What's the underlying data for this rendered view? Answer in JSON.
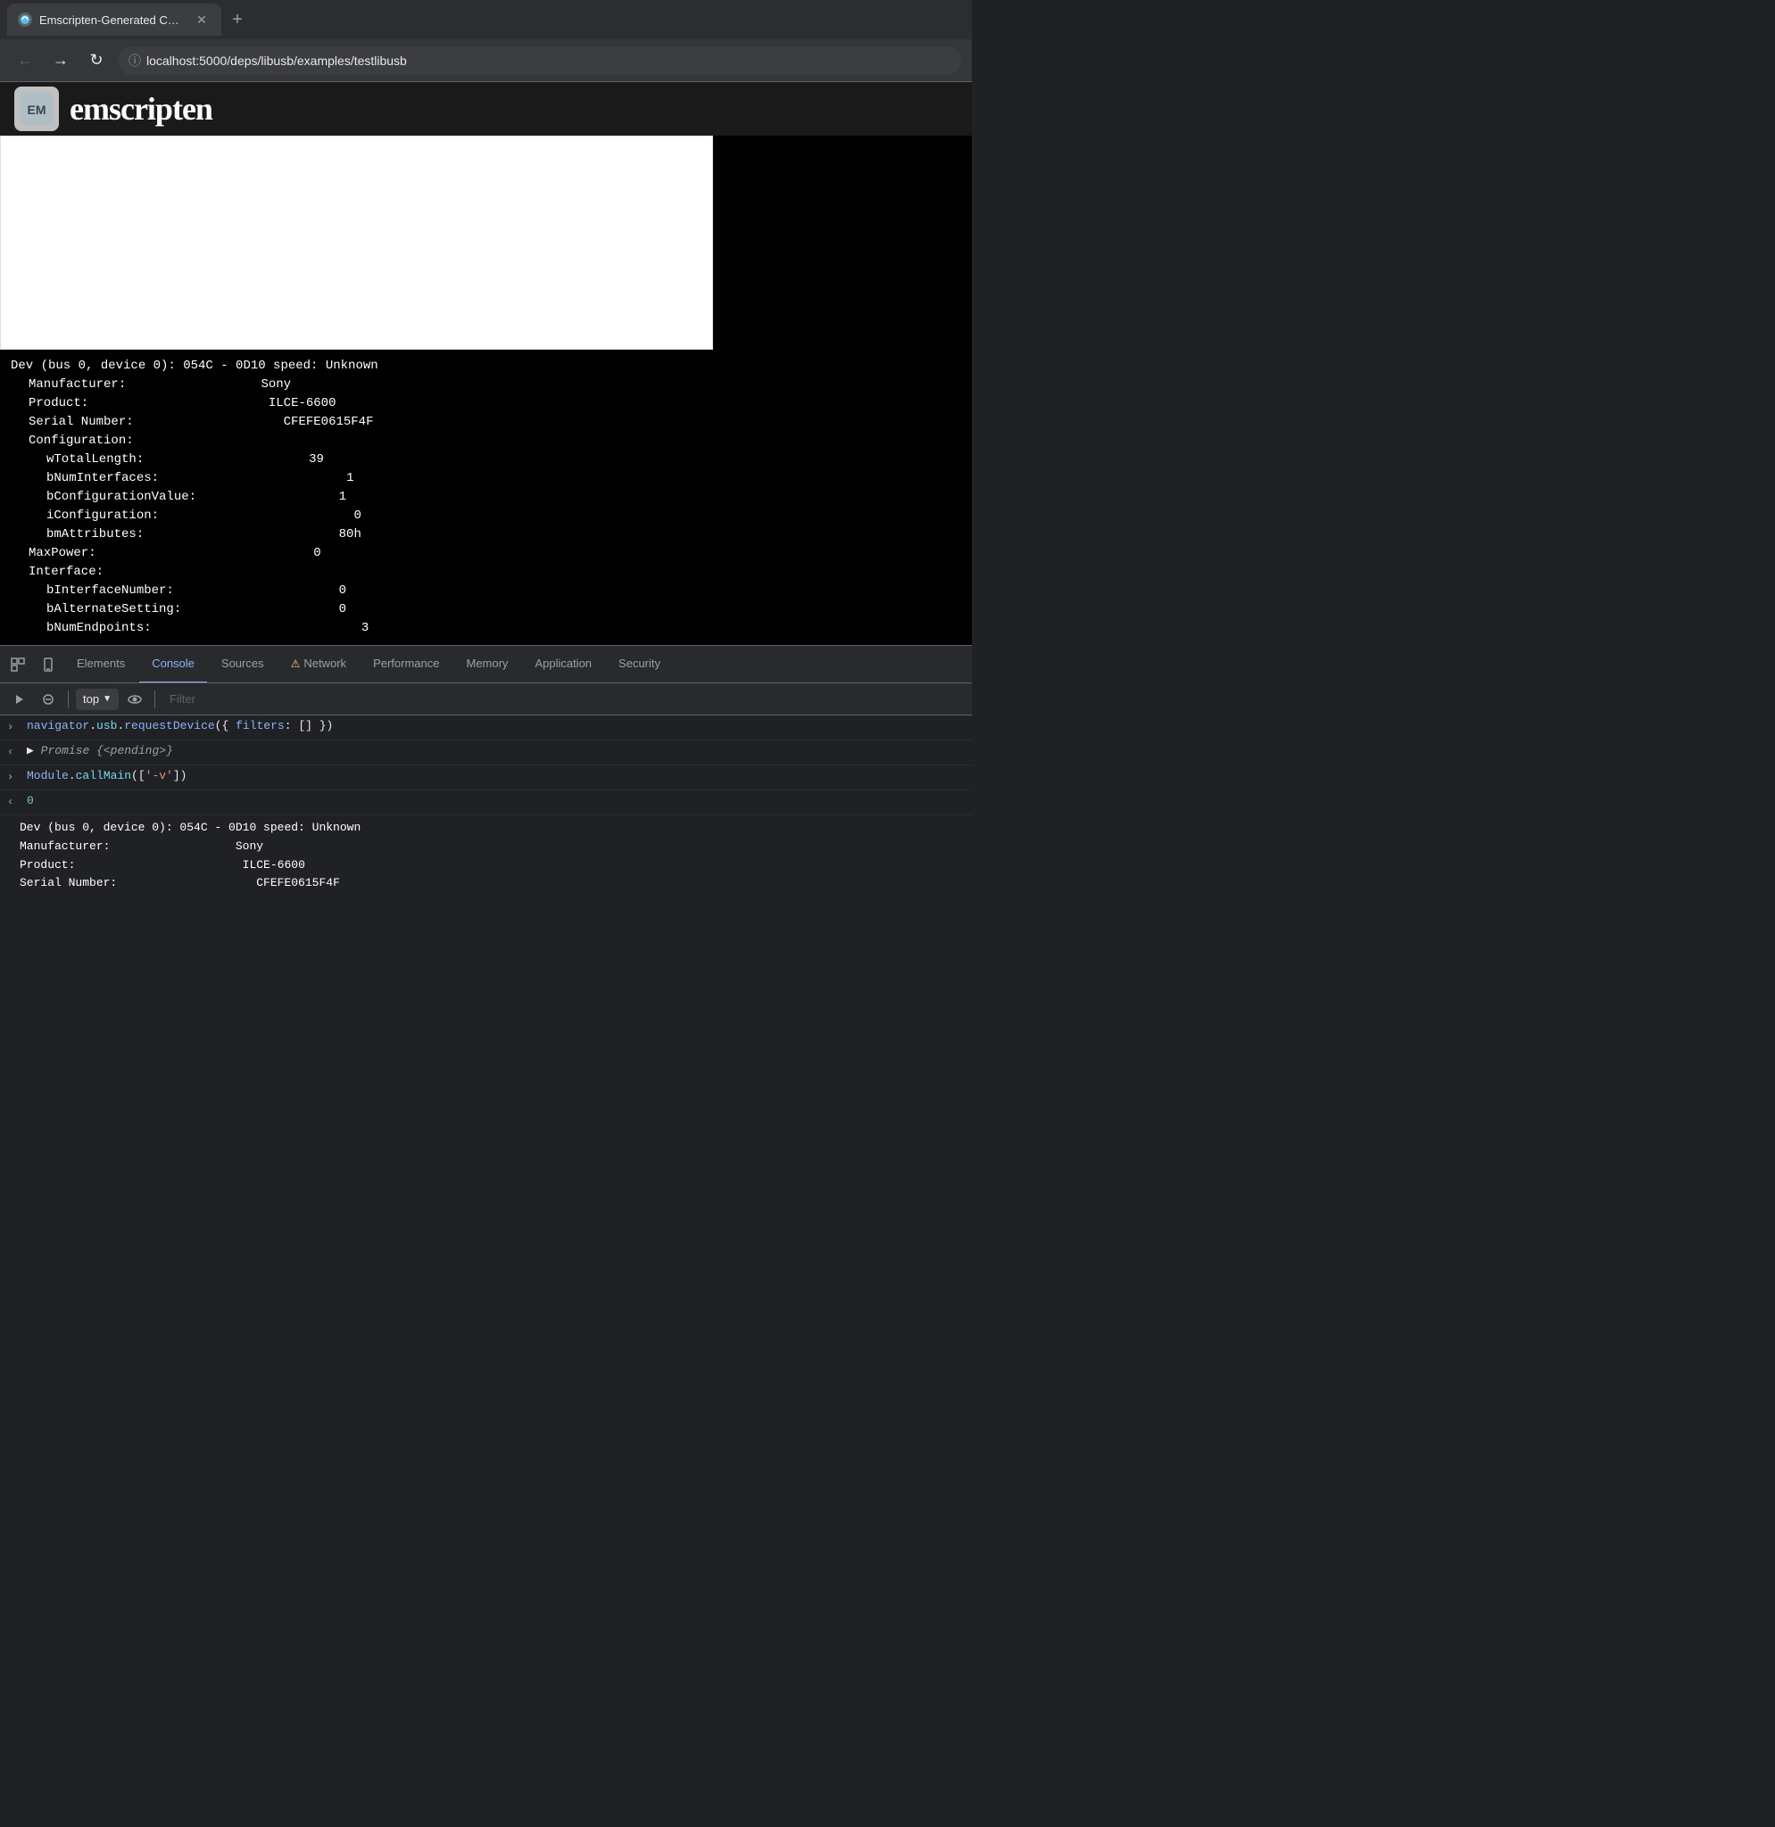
{
  "browser": {
    "tab_title": "Emscripten-Generated Code",
    "url": "localhost:5000/deps/libusb/examples/testlibusb",
    "new_tab_label": "+"
  },
  "devtools": {
    "tabs": [
      {
        "id": "elements",
        "label": "Elements",
        "active": false
      },
      {
        "id": "console",
        "label": "Console",
        "active": true
      },
      {
        "id": "sources",
        "label": "Sources",
        "active": false
      },
      {
        "id": "network",
        "label": "Network",
        "active": false,
        "warning": true
      },
      {
        "id": "performance",
        "label": "Performance",
        "active": false
      },
      {
        "id": "memory",
        "label": "Memory",
        "active": false
      },
      {
        "id": "application",
        "label": "Application",
        "active": false
      },
      {
        "id": "security",
        "label": "Security",
        "active": false
      }
    ],
    "toolbar": {
      "top_label": "top",
      "filter_placeholder": "Filter"
    },
    "console_lines": [
      {
        "type": "input",
        "arrow": ">",
        "content": "navigator.usb.requestDevice({ filters: [] })"
      },
      {
        "type": "output",
        "arrow": "<",
        "content": "Promise {<pending>}",
        "italic": true
      },
      {
        "type": "input",
        "arrow": ">",
        "content": "Module.callMain(['-v'])"
      },
      {
        "type": "output",
        "arrow": "<",
        "content": "0",
        "value_type": "number"
      }
    ]
  },
  "terminal_main": {
    "line1": "Dev (bus 0, device 0): 054C - 0D10 speed: Unknown",
    "manufacturer_label": "Manufacturer:",
    "manufacturer_value": "Sony",
    "product_label": "Product:",
    "product_value": "ILCE-6600",
    "serial_label": "Serial Number:",
    "serial_value": "CFEFE0615F4F",
    "config_label": "Configuration:",
    "wtotal_label": "wTotalLength:",
    "wtotal_value": "39",
    "bnum_label": "bNumInterfaces:",
    "bnum_value": "1",
    "bconfig_label": "bConfigurationValue:",
    "bconfig_value": "1",
    "iconfig_label": "iConfiguration:",
    "iconfig_value": "0",
    "bmattr_label": "bmAttributes:",
    "bmattr_value": "80h",
    "maxpower_label": "MaxPower:",
    "maxpower_value": "0",
    "interface_label": "Interface:",
    "binterface_label": "bInterfaceNumber:",
    "binterface_value": "0",
    "balternate_label": "bAlternateSetting:",
    "balternate_value": "0",
    "bnumep_label": "bNumEndpoints:",
    "bnumep_value": "3"
  },
  "terminal_console": {
    "line1": "Dev (bus 0, device 0): 054C - 0D10 speed: Unknown",
    "manufacturer_label": "Manufacturer:",
    "manufacturer_value": "Sony",
    "product_label": "Product:",
    "product_value": "ILCE-6600",
    "serial_label": "Serial Number:",
    "serial_value": "CFEFE0615F4F"
  },
  "emscripten": {
    "title": "emscripten"
  }
}
